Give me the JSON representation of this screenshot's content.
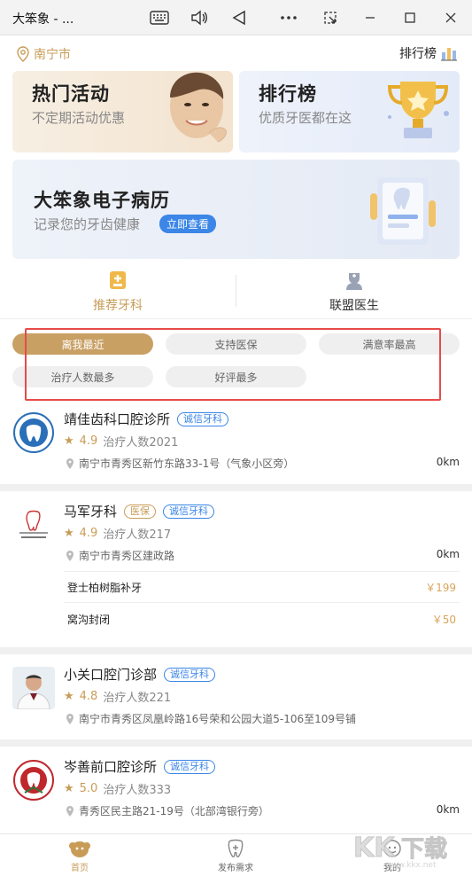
{
  "window": {
    "title": "大笨象 - ...",
    "icons": [
      "keyboard-icon",
      "volume-icon",
      "back-triangle-icon",
      "more-dots-icon",
      "screen-cast-icon",
      "minimize-icon",
      "maximize-icon",
      "close-icon"
    ]
  },
  "header": {
    "city": "南宁市",
    "rank_link": "排行榜"
  },
  "banners": {
    "hot": {
      "title": "热门活动",
      "subtitle": "不定期活动优惠"
    },
    "rank": {
      "title": "排行榜",
      "subtitle": "优质牙医都在这"
    },
    "emr": {
      "title": "大笨象电子病历",
      "subtitle": "记录您的牙齿健康",
      "button": "立即查看"
    }
  },
  "tabs": [
    {
      "label": "推荐牙科",
      "active": true,
      "icon": "clinic-icon"
    },
    {
      "label": "联盟医生",
      "active": false,
      "icon": "doctor-icon"
    }
  ],
  "filters": [
    {
      "label": "离我最近",
      "active": true
    },
    {
      "label": "支持医保",
      "active": false
    },
    {
      "label": "满意率最高",
      "active": false
    },
    {
      "label": "治疗人数最多",
      "active": false
    },
    {
      "label": "好评最多",
      "active": false
    }
  ],
  "clinics": [
    {
      "name": "靖佳齿科口腔诊所",
      "badges": [
        "诚信牙科"
      ],
      "rating": "4.9",
      "patients": "治疗人数2021",
      "address": "南宁市青秀区新竹东路33-1号（气象小区旁）",
      "distance": "0km"
    },
    {
      "name": "马军牙科",
      "badges": [
        "医保",
        "诚信牙科"
      ],
      "rating": "4.9",
      "patients": "治疗人数217",
      "address": "南宁市青秀区建政路",
      "distance": "0km",
      "services": [
        {
          "name": "登士柏树脂补牙",
          "price": "￥199"
        },
        {
          "name": "窝沟封闭",
          "price": "￥50"
        }
      ]
    },
    {
      "name": "小关口腔门诊部",
      "badges": [
        "诚信牙科"
      ],
      "rating": "4.8",
      "patients": "治疗人数221",
      "address": "南宁市青秀区凤凰岭路16号荣和公园大道5-106至109号铺",
      "distance": ""
    },
    {
      "name": "岑善前口腔诊所",
      "badges": [
        "诚信牙科"
      ],
      "rating": "5.0",
      "patients": "治疗人数333",
      "address": "青秀区民主路21-19号（北部湾银行旁）",
      "distance": "0km"
    }
  ],
  "bottom_nav": [
    {
      "label": "首页",
      "active": true,
      "icon": "home-icon"
    },
    {
      "label": "发布需求",
      "active": false,
      "icon": "tooth-plus-icon"
    },
    {
      "label": "我的",
      "active": false,
      "icon": "profile-icon"
    }
  ],
  "colors": {
    "accent": "#c89c57",
    "blue": "#3a86e6",
    "highlight_box": "#e84a4a"
  }
}
